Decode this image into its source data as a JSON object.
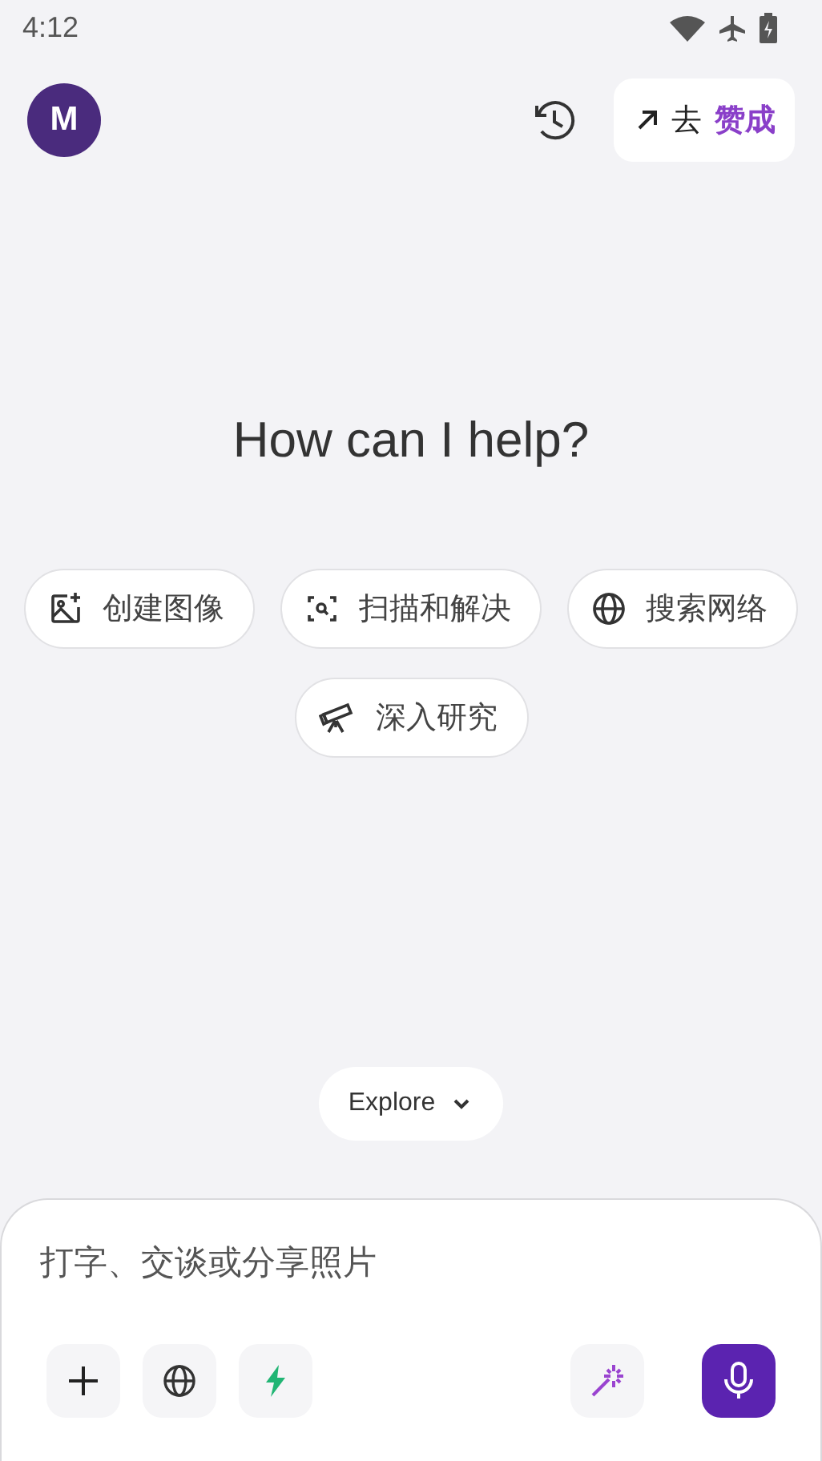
{
  "status_bar": {
    "time": "4:12"
  },
  "header": {
    "avatar": "M",
    "upgrade_button": {
      "label": "去",
      "highlight": "赞成"
    }
  },
  "greeting": "How can I help?",
  "suggestions": [
    {
      "kind": "image",
      "label": "创建图像"
    },
    {
      "kind": "scan",
      "label": "扫描和解决"
    },
    {
      "kind": "globe",
      "label": "搜索网络"
    },
    {
      "kind": "telescope",
      "label": "深入研究"
    }
  ],
  "explore_button": {
    "label": "Explore"
  },
  "composer": {
    "placeholder": "打字、交谈或分享照片"
  }
}
